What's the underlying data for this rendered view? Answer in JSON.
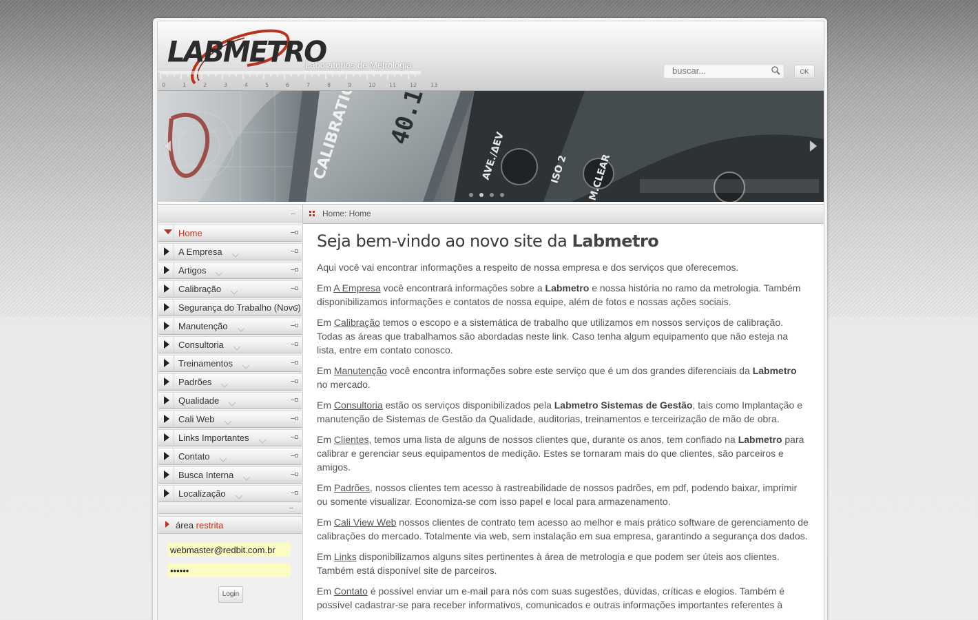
{
  "header": {
    "logo_text": "LABMETRO",
    "tagline": "Laboratórios de Metrologia",
    "ruler_numbers": [
      "0",
      "1",
      "2",
      "3",
      "4",
      "5",
      "6",
      "7",
      "8",
      "9",
      "10",
      "11",
      "12",
      "13"
    ],
    "search_placeholder": "buscar...",
    "search_button": "OK"
  },
  "banner": {
    "slides_count": 4,
    "active_slide": 1
  },
  "breadcrumb": "Home: Home",
  "sidebar": {
    "items": [
      {
        "label": "Home",
        "active": true
      },
      {
        "label": "A Empresa",
        "active": false
      },
      {
        "label": "Artigos",
        "active": false
      },
      {
        "label": "Calibração",
        "active": false
      },
      {
        "label": "Segurança do Trabalho (Novo)",
        "active": false
      },
      {
        "label": "Manutenção",
        "active": false
      },
      {
        "label": "Consultoria",
        "active": false
      },
      {
        "label": "Treinamentos",
        "active": false
      },
      {
        "label": "Padrões",
        "active": false
      },
      {
        "label": "Qualidade",
        "active": false
      },
      {
        "label": "Cali Web",
        "active": false
      },
      {
        "label": "Links Importantes",
        "active": false
      },
      {
        "label": "Contato",
        "active": false
      },
      {
        "label": "Busca Interna",
        "active": false
      },
      {
        "label": "Localização",
        "active": false
      }
    ],
    "restricted_prefix": "área",
    "restricted_highlight": "restrita",
    "login_email": "webmaster@redbit.com.br",
    "login_password": "••••••",
    "login_button": "Login"
  },
  "content": {
    "title_prefix": "Seja bem-vindo ao novo site da",
    "title_brand": "Labmetro",
    "intro": "Aqui você vai encontrar informações a respeito de nossa empresa e dos serviços que oferecemos.",
    "paragraphs": [
      {
        "pre": "Em ",
        "link": "A Empresa",
        "post": " você encontrará informações sobre a ",
        "bold": "Labmetro",
        "post2": " e nossa história no ramo da metrologia. Também disponibilizamos informações e contatos de nossa equipe, além de fotos e nossas ações sociais."
      },
      {
        "pre": "Em ",
        "link": "Calibração",
        "post": " temos o escopo e a sistemática de trabalho que utilizamos em nossos serviços de calibração. Todas as áreas que trabalhamos são abordadas neste link. Caso tenha algum equipamento que não esteja na lista, entre em contato conosco.",
        "bold": "",
        "post2": ""
      },
      {
        "pre": "Em ",
        "link": "Manutenção",
        "post": " você encontra informações sobre este serviço que é um dos grandes diferenciais da ",
        "bold": "Labmetro",
        "post2": " no mercado."
      },
      {
        "pre": "Em ",
        "link": "Consultoria",
        "post": " estão os serviços disponibilizados pela ",
        "bold": "Labmetro Sistemas de Gestão",
        "post2": ", tais como Implantação e manutenção de Sistemas de Gestão da Qualidade, auditorias, treinamentos e terceirização de mão de obra."
      },
      {
        "pre": "Em ",
        "link": "Clientes",
        "post": ", temos uma lista de alguns de nossos clientes que, durante os anos, tem confiado na ",
        "bold": "Labmetro",
        "post2": " para calibrar e gerenciar seus equipamentos de medição. Estes se tornaram mais do que clientes, são parceiros e amigos."
      },
      {
        "pre": "Em ",
        "link": "Padrões",
        "post": ", nossos clientes tem acesso à rastreabilidade de nossos padrões, em pdf, podendo baixar, imprimir ou somente visualizar. Economiza-se com isso papel e local para armazenamento.",
        "bold": "",
        "post2": ""
      },
      {
        "pre": "Em ",
        "link": "Cali View Web",
        "post": " nossos clientes de contrato tem acesso ao melhor e mais prático software de gerenciamento de calibrações do mercado. Totalmente via web, sem instalação em sua empresa, garantindo a segurança dos dados.",
        "bold": "",
        "post2": ""
      },
      {
        "pre": "Em ",
        "link": "Links",
        "post": " disponibilizamos alguns sites pertinentes à área de metrologia e que podem ser úteis aos clientes. Também está disponível site de parceiros.",
        "bold": "",
        "post2": ""
      },
      {
        "pre": "Em ",
        "link": "Contato",
        "post": " é possível enviar um e-mail  para nós com suas sugestões, dúvidas, críticas e elogios. Também é possível cadastrar-se para receber informativos, comunicados e outras informações importantes referentes à",
        "bold": "",
        "post2": ""
      }
    ]
  },
  "colors": {
    "accent": "#b8321f",
    "text": "#555555",
    "login_field_bg": "#fafcc4"
  }
}
